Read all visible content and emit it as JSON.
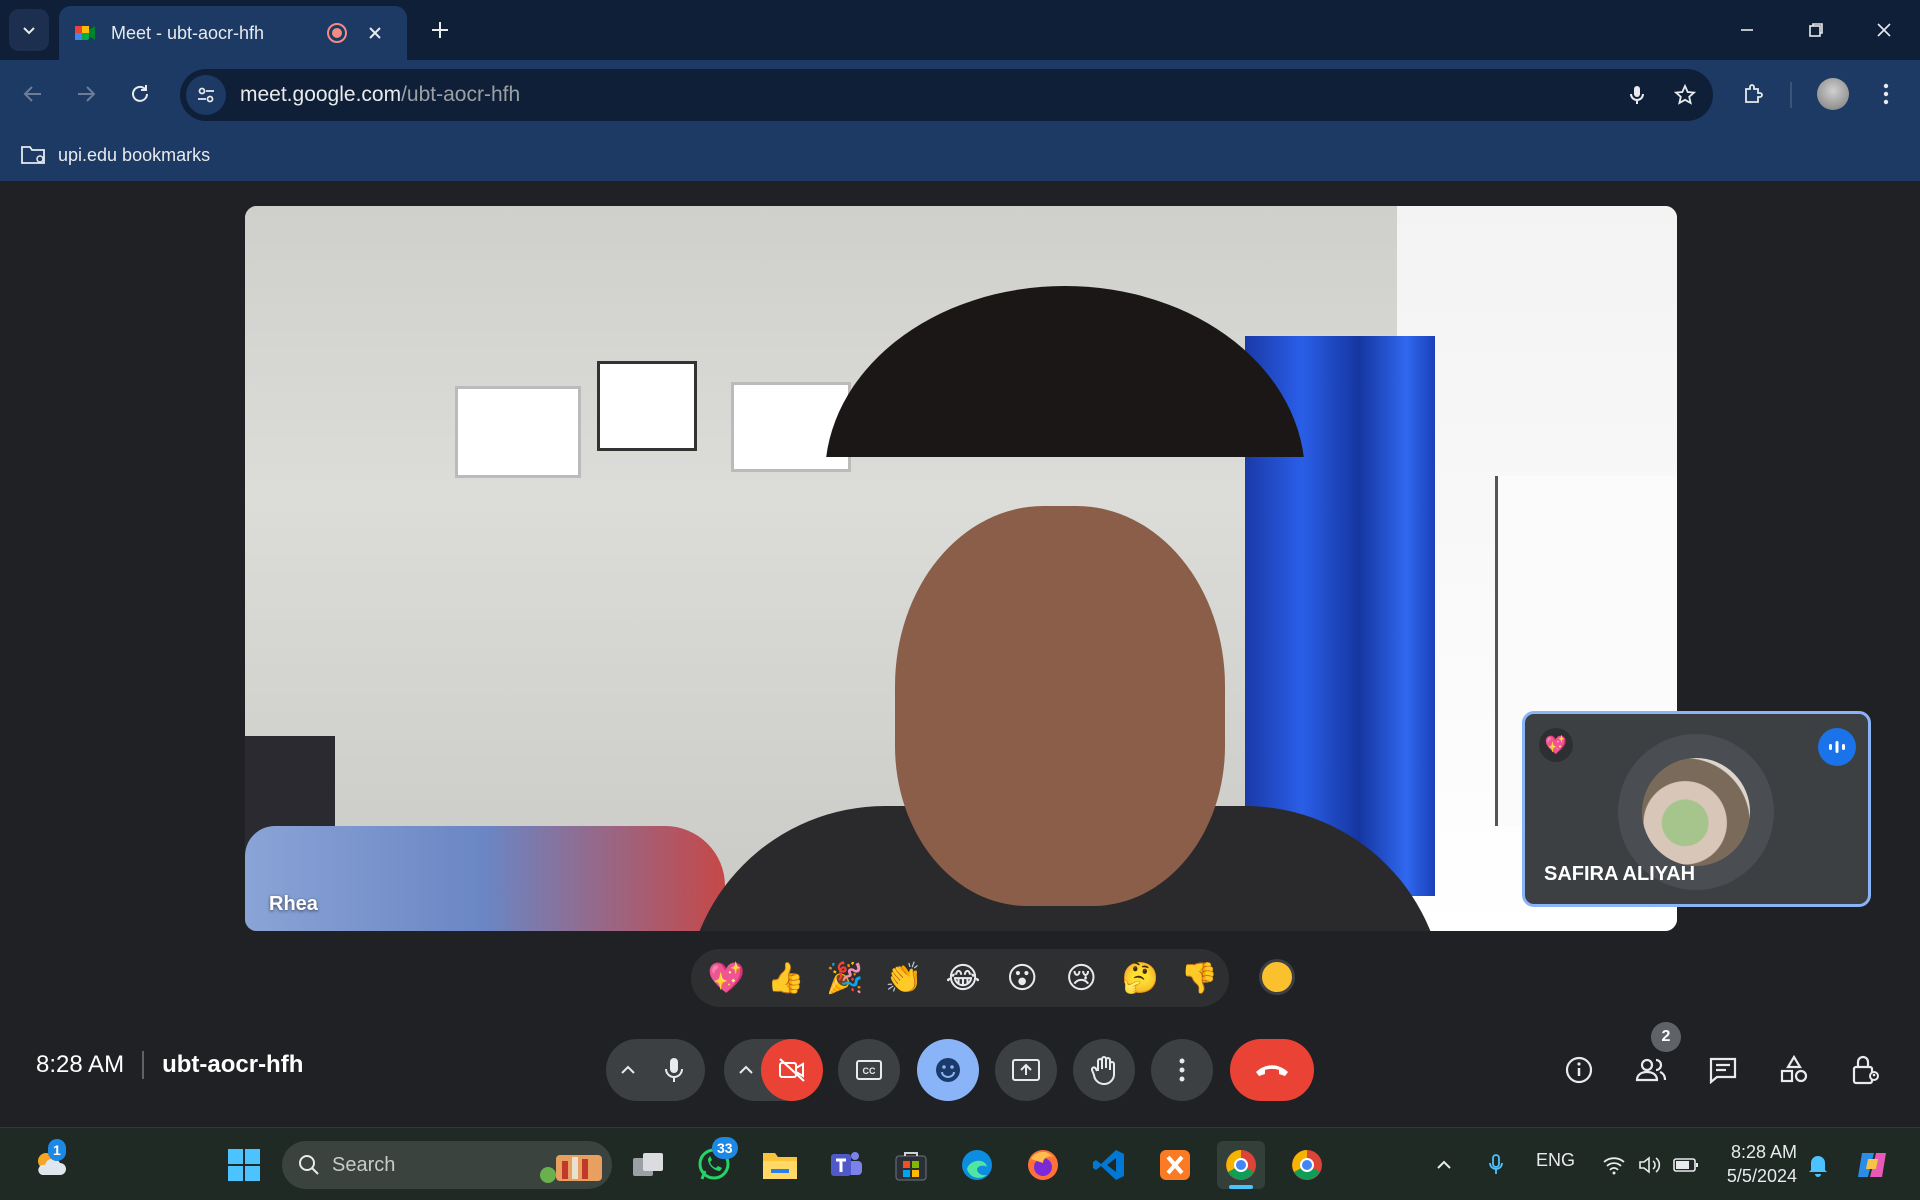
{
  "browser": {
    "tab_title": "Meet - ubt-aocr-hfh",
    "url_host": "meet.google.com",
    "url_path": "/ubt-aocr-hfh",
    "bookmark_folder": "upi.edu bookmarks"
  },
  "meet": {
    "main_speaker": "Rhea",
    "self_name": "SAFIRA ALIYAH",
    "self_reaction": "💖",
    "reactions": [
      "💖",
      "👍",
      "🎉",
      "👏",
      "😂",
      "😮",
      "😢",
      "🤔",
      "👎"
    ],
    "time": "8:28 AM",
    "meeting_code": "ubt-aocr-hfh",
    "participant_count": "2",
    "colors": {
      "end_call": "#ea4335",
      "camera_off": "#ea4335",
      "active": "#8ab4f8",
      "accent": "#1a73e8"
    }
  },
  "taskbar": {
    "weather_badge": "1",
    "search_label": "Search",
    "whatsapp_badge": "33",
    "language": "ENG",
    "clock_time": "8:28 AM",
    "clock_date": "5/5/2024"
  },
  "icons": [
    "chevron-down-icon",
    "meet-favicon",
    "recording-icon",
    "close-icon",
    "plus-icon",
    "minimize-icon",
    "restore-icon",
    "back-icon",
    "forward-icon",
    "reload-icon",
    "site-info-icon",
    "microphone-icon",
    "star-icon",
    "extensions-icon",
    "profile-icon",
    "menu-icon",
    "folder-icon"
  ]
}
